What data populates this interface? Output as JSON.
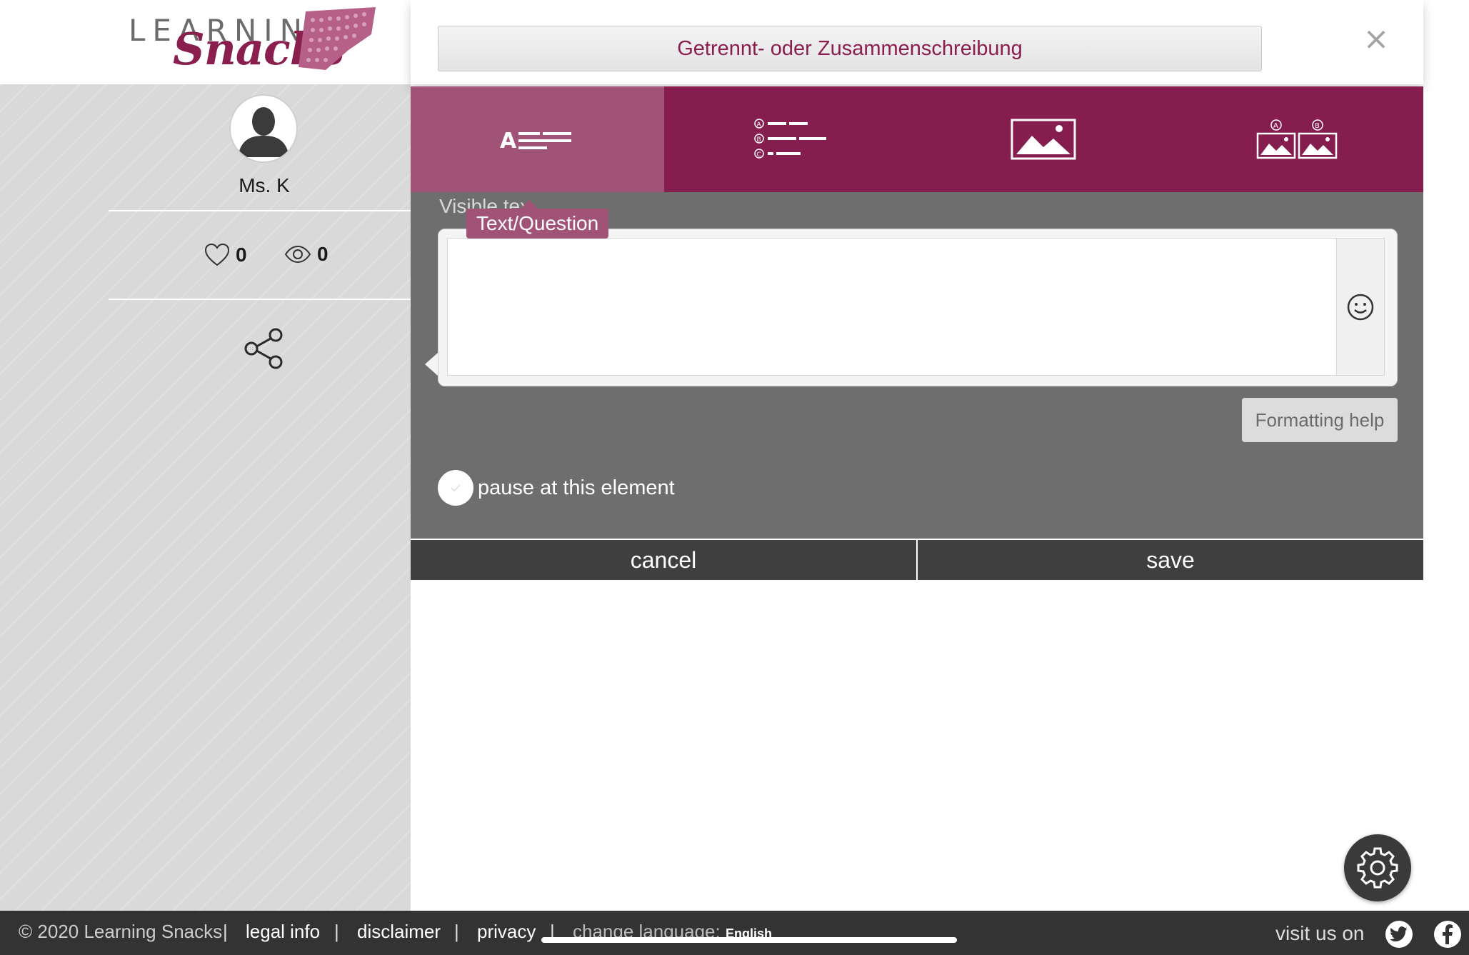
{
  "logo": {
    "learning": "LEARNING",
    "snacks": "Snacks"
  },
  "profile": {
    "name": "Ms. K",
    "likes": "0",
    "views": "0"
  },
  "header": {
    "title": "Getrennt- oder Zusammenschreibung",
    "close": "×"
  },
  "tabs": [
    {
      "name": "text-question",
      "icon": "text-lines-icon",
      "active": true
    },
    {
      "name": "multiple-choice",
      "icon": "abc-list-icon",
      "active": false
    },
    {
      "name": "image",
      "icon": "image-icon",
      "active": false
    },
    {
      "name": "image-choice",
      "icon": "two-images-icon",
      "active": false
    }
  ],
  "editor": {
    "visible_text_label": "Visible tex",
    "tooltip": "Text/Question",
    "text_value": "",
    "formatting_help": "Formatting help",
    "pause_label": "pause at this element"
  },
  "actions": {
    "cancel": "cancel",
    "save": "save"
  },
  "footer": {
    "copyright": "© 2020 Learning Snacks",
    "legal": "legal info",
    "disclaimer": "disclaimer",
    "privacy": "privacy",
    "change_language": "change language:",
    "language": "English",
    "visit": "visit us on"
  },
  "colors": {
    "brand": "#861d4f",
    "brand_light": "#a05377",
    "editor_bg": "#6e6e6e",
    "footer_bg": "#333333"
  }
}
